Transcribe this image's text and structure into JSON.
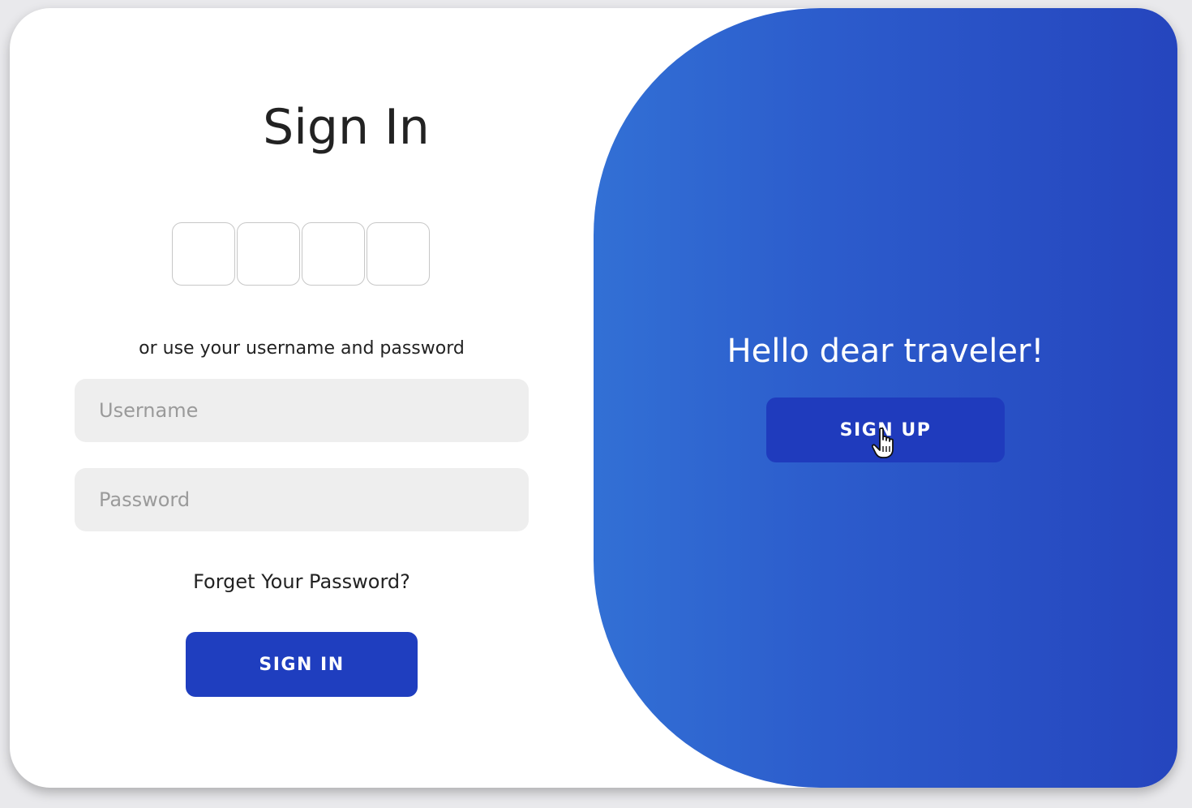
{
  "signin": {
    "title": "Sign In",
    "code_boxes": [
      "",
      "",
      "",
      ""
    ],
    "alt_text": "or use your username and password",
    "username_placeholder": "Username",
    "password_placeholder": "Password",
    "forgot_link": "Forget Your Password?",
    "button_label": "SIGN IN"
  },
  "overlay": {
    "greeting": "Hello dear traveler!",
    "button_label": "SIGN UP"
  },
  "colors": {
    "primary_button": "#1f3ebf",
    "gradient_start": "#3270d5",
    "gradient_end": "#2545be",
    "input_bg": "#eeeeee"
  },
  "cursor": {
    "icon": "hand-pointer-icon"
  }
}
